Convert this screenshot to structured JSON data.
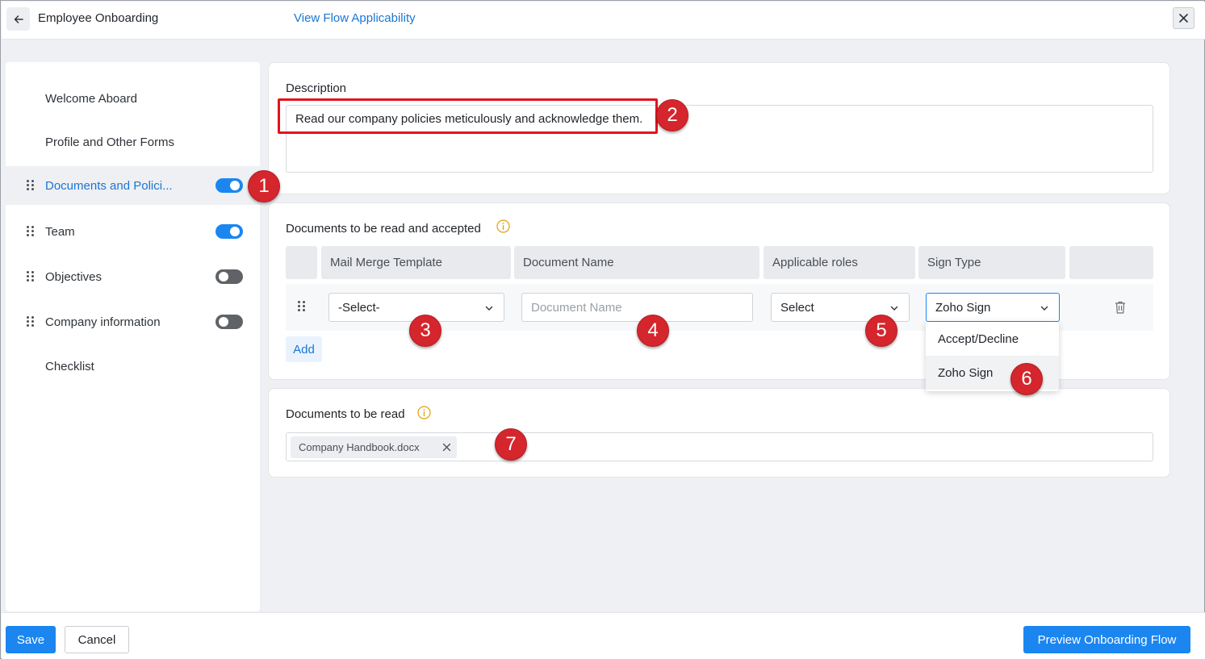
{
  "header": {
    "title": "Employee Onboarding",
    "link": "View Flow Applicability"
  },
  "sidebar": {
    "items": [
      {
        "label": "Welcome Aboard",
        "draggable": false,
        "toggle": null,
        "active": false
      },
      {
        "label": "Profile and Other Forms",
        "draggable": false,
        "toggle": null,
        "active": false
      },
      {
        "label": "Documents and Polici...",
        "draggable": true,
        "toggle": "on",
        "active": true
      },
      {
        "label": "Team",
        "draggable": true,
        "toggle": "on",
        "active": false
      },
      {
        "label": "Objectives",
        "draggable": true,
        "toggle": "off",
        "active": false
      },
      {
        "label": "Company information",
        "draggable": true,
        "toggle": "off",
        "active": false
      },
      {
        "label": "Checklist",
        "draggable": false,
        "toggle": null,
        "active": false
      }
    ]
  },
  "description": {
    "label": "Description",
    "value": "Read our company policies meticulously and acknowledge them."
  },
  "docs_accept": {
    "title": "Documents to be read and accepted",
    "columns": [
      "Mail Merge Template",
      "Document Name",
      "Applicable roles",
      "Sign Type"
    ],
    "row": {
      "template": "-Select-",
      "name_placeholder": "Document Name",
      "roles": "Select",
      "sign_type": "Zoho Sign"
    },
    "add_label": "Add",
    "sign_options": [
      "Accept/Decline",
      "Zoho Sign"
    ]
  },
  "docs_read": {
    "title": "Documents to be read",
    "files": [
      "Company Handbook.docx"
    ]
  },
  "badges": [
    "1",
    "2",
    "3",
    "4",
    "5",
    "6",
    "7"
  ],
  "footer": {
    "save": "Save",
    "cancel": "Cancel",
    "preview": "Preview Onboarding Flow"
  },
  "colors": {
    "accent": "#1b86f0",
    "link": "#1b76d3",
    "badge": "#d4262c",
    "highlight": "#e3141b",
    "info": "#e3a008"
  }
}
